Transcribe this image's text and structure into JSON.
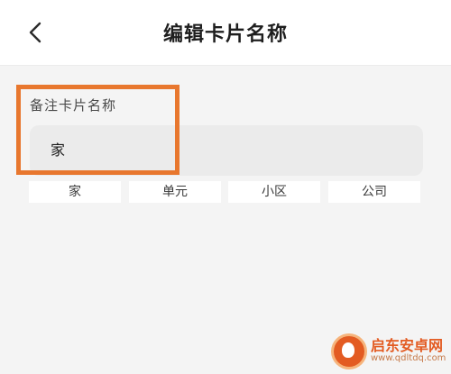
{
  "header": {
    "title": "编辑卡片名称",
    "back_icon": "chevron-left-icon"
  },
  "form": {
    "label": "备注卡片名称",
    "value": "家"
  },
  "chips": [
    {
      "label": "家"
    },
    {
      "label": "单元"
    },
    {
      "label": "小区"
    },
    {
      "label": "公司"
    }
  ],
  "watermark": {
    "name": "启东安卓网",
    "url": "www.qdltdq.com"
  },
  "colors": {
    "highlight": "#e8772e",
    "background": "#f4f4f4",
    "input_bg": "#ebebeb"
  }
}
